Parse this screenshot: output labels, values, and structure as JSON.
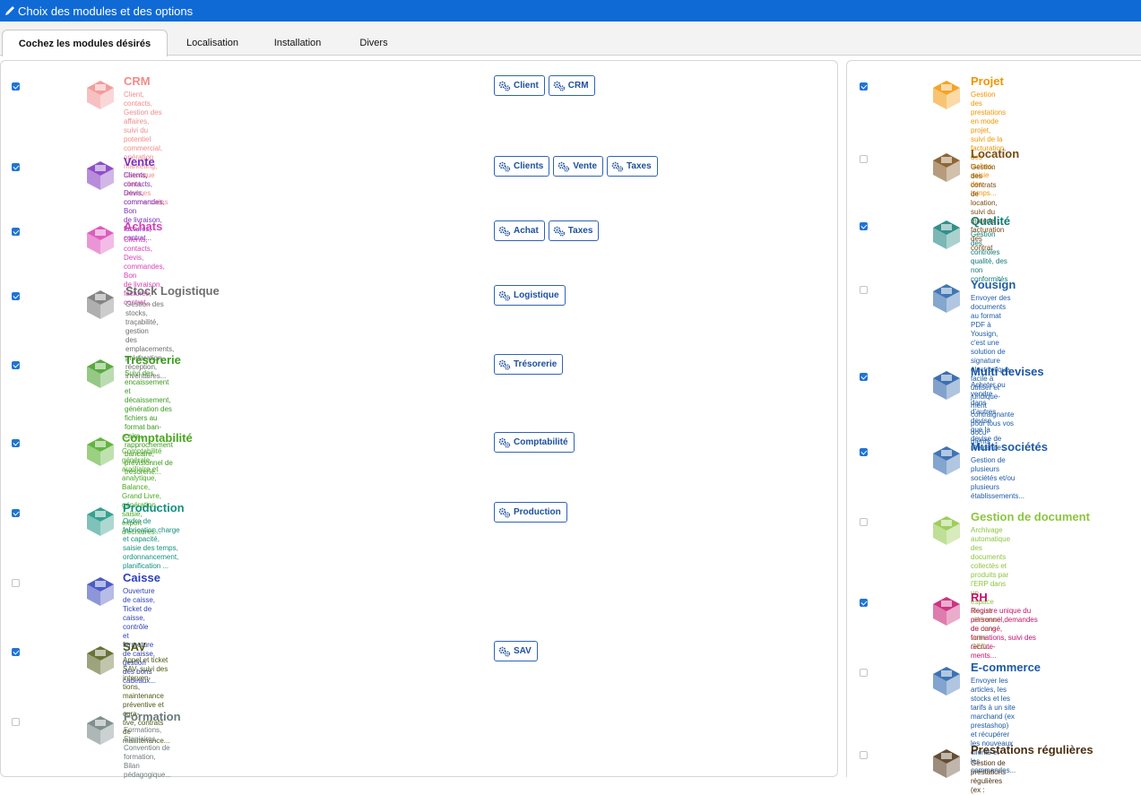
{
  "window": {
    "title": "Choix des modules et des options"
  },
  "tabs": [
    {
      "label": "Cochez les modules désirés",
      "active": true
    },
    {
      "label": "Localisation",
      "active": false
    },
    {
      "label": "Installation",
      "active": false
    },
    {
      "label": "Divers",
      "active": false
    }
  ],
  "left_modules": [
    {
      "id": "crm",
      "checked": true,
      "title": "CRM",
      "color": "#f08c8c",
      "icon": "crm-board-icon",
      "desc": [
        "Client, contacts, Gestion des affaires,",
        "suivi du potentiel commercial, opération",
        "marketing, historique client, relances",
        "commerciales"
      ],
      "options": [
        "Client",
        "CRM"
      ]
    },
    {
      "id": "vente",
      "checked": true,
      "title": "Vente",
      "color": "#7b2fbe",
      "icon": "sales-computer-icon",
      "desc": [
        "Clients, contacts, Devis, commandes, Bon",
        "de livraison, factures, contrat..."
      ],
      "options": [
        "Clients",
        "Vente",
        "Taxes"
      ]
    },
    {
      "id": "achats",
      "checked": true,
      "title": "Achats",
      "color": "#d93fb5",
      "icon": "shopping-cart-icon",
      "desc": [
        "Clients, contacts, Devis, commandes, Bon",
        "de livraison, factures, contrat..."
      ],
      "options": [
        "Achat",
        "Taxes"
      ]
    },
    {
      "id": "stock",
      "checked": true,
      "title": "Stock Logistique",
      "color": "#6e6e6e",
      "icon": "warehouse-icon",
      "desc": [
        "Gestion des stocks, traçabilité, gestion",
        "des emplacements, préparation,",
        "réception, inventaires..."
      ],
      "options": [
        "Logistique"
      ]
    },
    {
      "id": "tresorerie",
      "checked": true,
      "title": "Trésorerie",
      "color": "#3c9a1f",
      "icon": "money-wallet-icon",
      "desc": [
        "Suivi des encaissement et décaissement,",
        "génération des fichiers au format ban-",
        "caire, rapprochement bancaire,",
        "prévisionnel de trésorerie..."
      ],
      "options": [
        "Trésorerie"
      ]
    },
    {
      "id": "compta",
      "checked": true,
      "title": "Comptabilité",
      "color": "#48a81c",
      "icon": "accounting-screen-icon",
      "desc": [
        "Comptabilité générale, auxiliaire et",
        "analytique,  Balance, Grand Livre,",
        "génération, saisie, export d'écritures..."
      ],
      "options": [
        "Comptabilité"
      ]
    },
    {
      "id": "production",
      "checked": true,
      "title": "Production",
      "color": "#14907f",
      "icon": "factory-icon",
      "desc": [
        "Ordre de fabrication,charge et capacité,",
        "saisie des temps, ordonnancement,",
        "planification ..."
      ],
      "options": [
        "Production"
      ]
    },
    {
      "id": "caisse",
      "checked": false,
      "title": "Caisse",
      "color": "#2e3fb8",
      "icon": "cash-register-icon",
      "desc": [
        "Ouverture de caisse, Ticket de caisse,",
        "contrôle et fermeture de caisse, gestion",
        "des bons cadeaux..."
      ],
      "options": []
    },
    {
      "id": "sav",
      "checked": true,
      "title": "SAV",
      "color": "#4d5a12",
      "icon": "support-headset-icon",
      "desc": [
        "Appel et ticket SAV, suivi des interven-",
        "tions, maintenance préventive et cura-",
        "tive, contrats de maintenance..."
      ],
      "options": [
        "SAV"
      ]
    },
    {
      "id": "formation",
      "checked": false,
      "title": "Formation",
      "color": "#6b7a7a",
      "icon": "training-board-icon",
      "desc": [
        "Formations, Stagiaires, Convention de",
        "formation, Bilan pédagogique..."
      ],
      "options": []
    }
  ],
  "right_modules": [
    {
      "id": "projet",
      "checked": true,
      "title": "Projet",
      "color": "#f29400",
      "icon": "lightbulb-gear-icon",
      "desc": [
        "Gestion des prestations en mode projet,",
        "suivi de la facturation, des taches, saisie",
        "des temps..."
      ]
    },
    {
      "id": "location",
      "checked": false,
      "title": "Location",
      "color": "#7a4a10",
      "icon": "contract-shield-icon",
      "desc": [
        "Gestion des contrats de location, suivi du",
        "matériel , facturation des contrat"
      ]
    },
    {
      "id": "qualite",
      "checked": true,
      "title": "Qualité",
      "color": "#0e7b76",
      "icon": "quality-badge-icon",
      "desc": [
        "Gestion des contrôles qualité, des non",
        "conformités"
      ]
    },
    {
      "id": "yousign",
      "checked": false,
      "title": "Yousign",
      "color": "#1f5ea8",
      "icon": "e-signature-icon",
      "desc": [
        "Envoyer des documents au format PDF à",
        "Yousign, c'est une solution de signature",
        "électronique facile à utiliser et juridique-",
        "ment contraignante pour tous vos docu-",
        "ments"
      ]
    },
    {
      "id": "devises",
      "checked": true,
      "title": "Multi devises",
      "color": "#1b56a3",
      "icon": "currency-coins-icon",
      "desc": [
        "Acheter ou vendre dans d'autres devise",
        "que la devise de référence..."
      ]
    },
    {
      "id": "societes",
      "checked": true,
      "title": "Multi sociétés",
      "color": "#1e5ba8",
      "icon": "multi-company-icon",
      "desc": [
        "Gestion de plusieurs sociétés et/ou",
        "plusieurs établissements..."
      ]
    },
    {
      "id": "ged",
      "checked": false,
      "title": "Gestion de document",
      "color": "#8cc53f",
      "icon": "document-archive-icon",
      "desc": [
        "Archivage automatique des documents",
        "collectés et produits par l'ERP dans un",
        "espace disque référencé ou dans votre",
        "GED..."
      ]
    },
    {
      "id": "rh",
      "checked": true,
      "title": "RH",
      "color": "#c4116b",
      "icon": "hr-profile-icon",
      "desc": [
        "Registre unique du personnel,demandes",
        "de congé, formations, suivi des recrute-",
        "ments..."
      ]
    },
    {
      "id": "ecommerce",
      "checked": false,
      "title": "E-commerce",
      "color": "#1b5aa6",
      "icon": "web-shop-icon",
      "desc": [
        "Envoyer les articles, les stocks et les",
        "tarifs à un site marchand (ex prestashop)",
        "et récupérer les nouveaux clients et",
        "les commandes..."
      ]
    },
    {
      "id": "prestations",
      "checked": false,
      "title": "Prestations régulières",
      "color": "#4a2e10",
      "icon": "recurring-service-icon",
      "desc": [
        "Gestion de prestations régulières (ex :"
      ]
    }
  ]
}
